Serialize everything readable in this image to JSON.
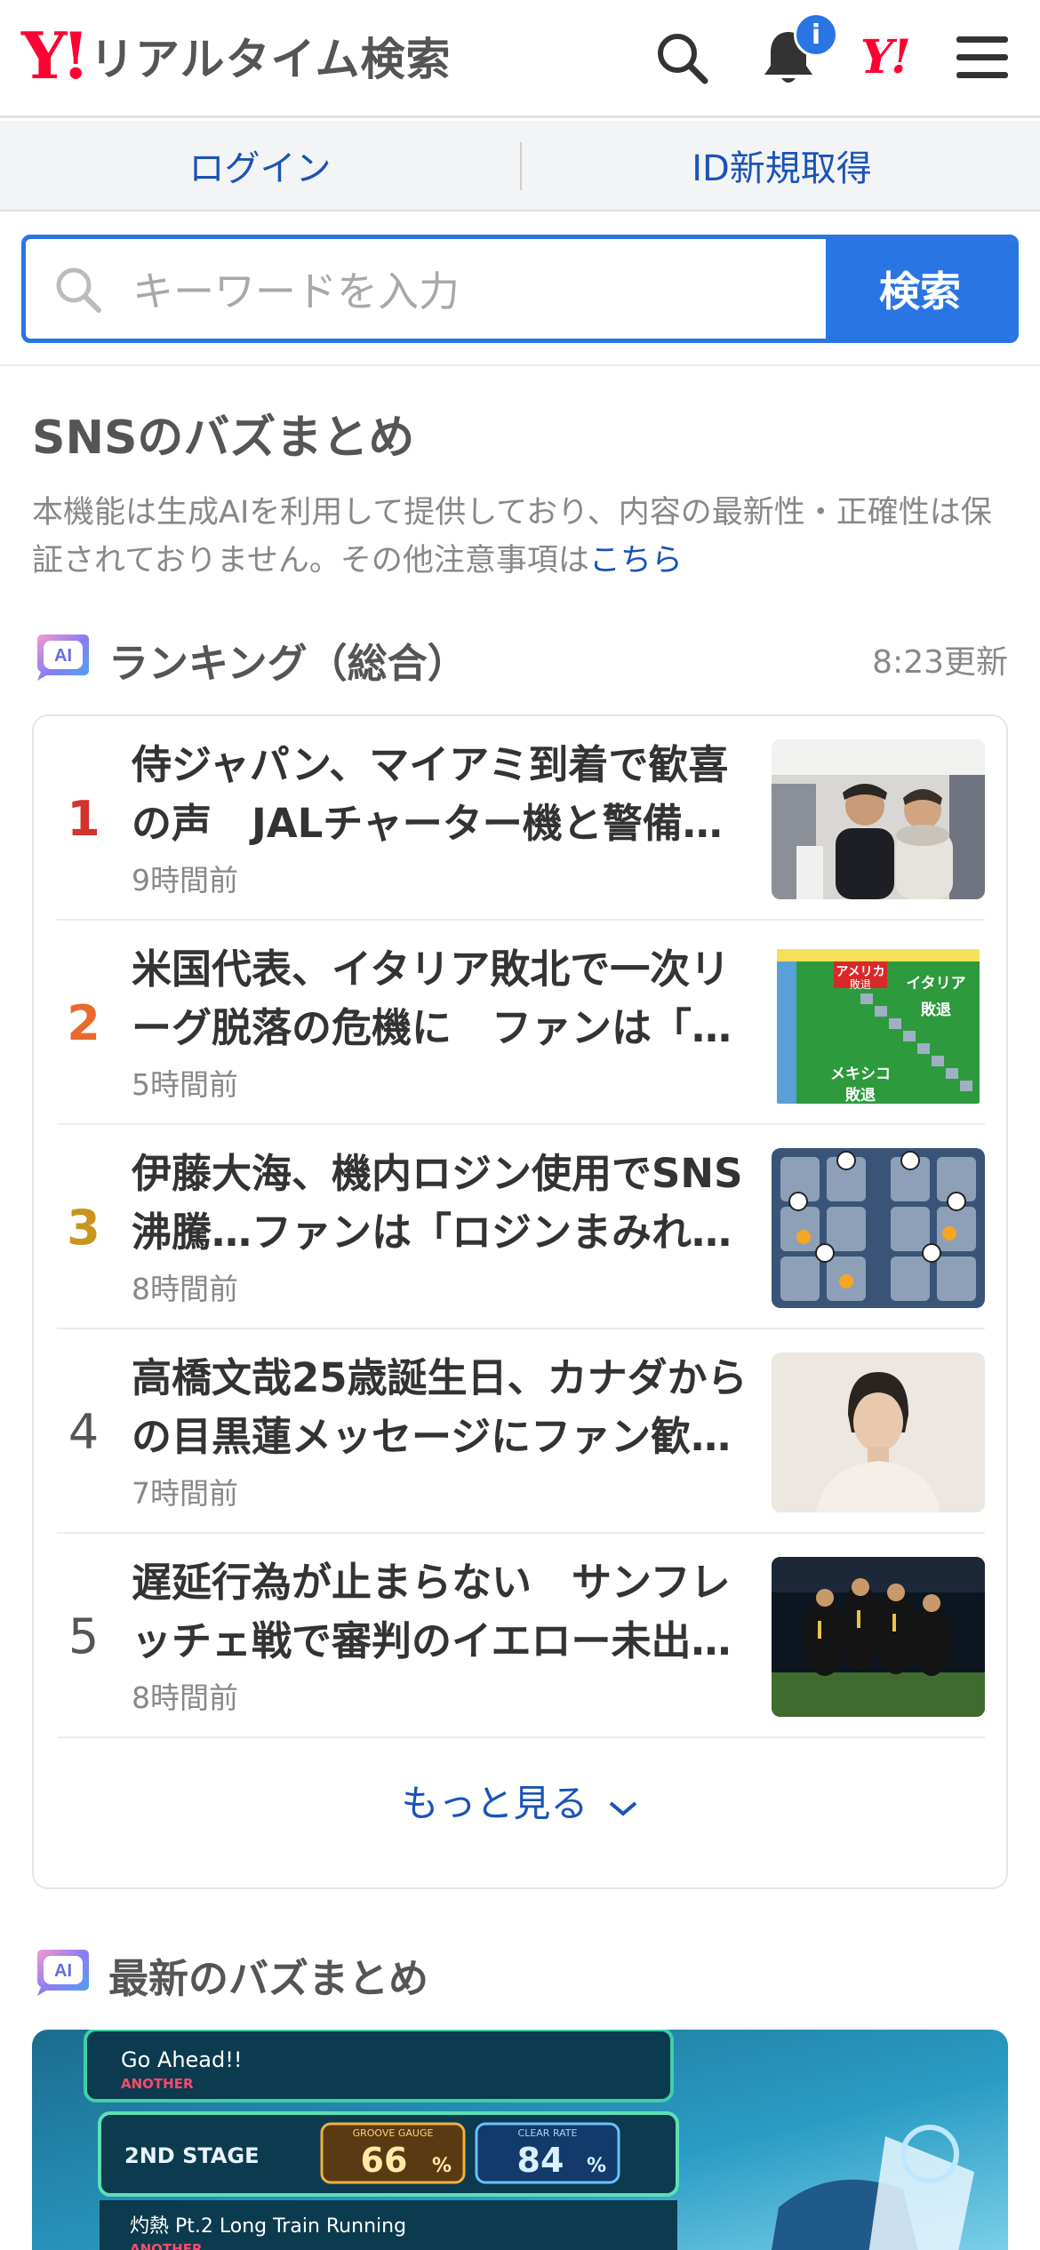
{
  "header": {
    "logo_mark": "Y!",
    "logo_text": "リアルタイム検索",
    "search_icon": "search-icon",
    "bell_icon": "bell-icon",
    "notification_badge": "i",
    "yahoo_mark": "Y!",
    "menu_icon": "hamburger-menu-icon"
  },
  "auth": {
    "login": "ログイン",
    "signup": "ID新規取得"
  },
  "search": {
    "placeholder": "キーワードを入力",
    "button": "検索"
  },
  "buzz": {
    "title": "SNSのバズまとめ",
    "notice_text": "本機能は生成AIを利用して提供しており、内容の最新性・正確性は保証されておりません。その他注意事項は",
    "notice_link": "こちら"
  },
  "ranking": {
    "ai_label": "AI",
    "title": "ランキング（総合）",
    "updated": "8:23更新",
    "items": [
      {
        "rank": "1",
        "title": "侍ジャパン、マイアミ到着で歓喜の声　JALチャーター機と警備…",
        "time": "9時間前",
        "rank_color": "#d0342c"
      },
      {
        "rank": "2",
        "title": "米国代表、イタリア敗北で一次リーグ脱落の危機に　ファンは「…",
        "time": "5時間前",
        "rank_color": "#e8692c"
      },
      {
        "rank": "3",
        "title": "伊藤大海、機内ロジン使用でSNS沸騰…ファンは「ロジンまみれ…",
        "time": "8時間前",
        "rank_color": "#c8961e"
      },
      {
        "rank": "4",
        "title": "高橋文哉25歳誕生日、カナダからの目黒蓮メッセージにファン歓…",
        "time": "7時間前",
        "rank_color": "#555555"
      },
      {
        "rank": "5",
        "title": "遅延行為が止まらない　サンフレッチェ戦で審判のイエロー未出…",
        "time": "8時間前",
        "rank_color": "#555555"
      }
    ],
    "thumb2": {
      "row1": "アメリカ",
      "row1b": "敗退",
      "label_italy": "イタリア",
      "label_italy2": "敗退",
      "label_mexico": "メキシコ",
      "label_mexico2": "敗退"
    },
    "more": "もっと見る"
  },
  "latest": {
    "ai_label": "AI",
    "title": "最新のバズまとめ",
    "image_text": {
      "song1": "Go Ahead!!",
      "tag1": "ANOTHER",
      "stage": "2ND STAGE",
      "gauge_label": "GROOVE GAUGE",
      "gauge_value": "66",
      "gauge_unit": "%",
      "clear_label": "CLEAR RATE",
      "clear_value": "84",
      "clear_unit": "%",
      "song2": "灼熱 Pt.2 Long Train Running",
      "tag2": "ANOTHER"
    }
  },
  "colors": {
    "accent": "#2a75e4",
    "link": "#1a54b6",
    "brand_red": "#ff0033"
  }
}
